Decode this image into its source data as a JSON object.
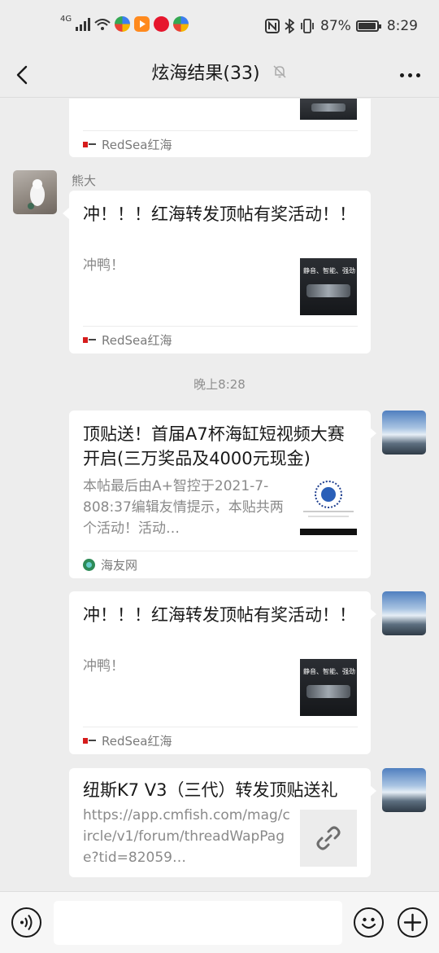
{
  "status_bar": {
    "network": "4G",
    "battery_percent": "87%",
    "time": "8:29"
  },
  "nav": {
    "title": "炫海结果(33)",
    "back_icon": "chevron-left-icon",
    "mute_icon": "bell-muted-icon",
    "more_icon": "more-dots-icon"
  },
  "messages": [
    {
      "kind": "link-card-partial",
      "source": "RedSea红海"
    },
    {
      "kind": "link-card",
      "sender": "熊大",
      "title": "冲！！！红海转发顶帖有奖活动！！",
      "desc": "冲鸭！",
      "thumb_text": "静音、智能、强劲",
      "source": "RedSea红海"
    },
    {
      "kind": "timestamp",
      "text": "晚上8:28"
    },
    {
      "kind": "link-card-self",
      "title": "顶贴送！首届A7杯海缸短视频大赛开启(三万奖品及4000元现金)",
      "desc": "本帖最后由A+智控于2021-7-808:37编辑友情提示，本贴共两个活动！活动…",
      "source": "海友网"
    },
    {
      "kind": "link-card-self",
      "title": "冲！！！红海转发顶帖有奖活动！！",
      "desc": "冲鸭！",
      "thumb_text": "静音、智能、强劲",
      "source": "RedSea红海"
    },
    {
      "kind": "link-card-self",
      "title": "纽斯K7 V3（三代）转发顶贴送礼",
      "desc": "https://app.cmfish.com/mag/circle/v1/forum/threadWapPage?tid=82059…",
      "link_icon": "link-icon"
    }
  ],
  "input_bar": {
    "voice_icon": "voice-icon",
    "emoji_icon": "emoji-icon",
    "plus_icon": "plus-icon"
  },
  "colors": {
    "background": "#ededed",
    "bubble": "#ffffff",
    "text": "#191919",
    "muted": "#8a8a8a"
  }
}
